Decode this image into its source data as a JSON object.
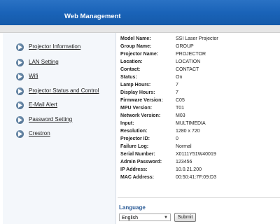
{
  "header": {
    "title": "Web Management"
  },
  "nav": {
    "items": [
      {
        "label": "Projector Information",
        "icon": "arrow-right-icon"
      },
      {
        "label": "LAN Setting",
        "icon": "arrow-right-icon"
      },
      {
        "label": "Wifi",
        "icon": "arrow-right-icon"
      },
      {
        "label": "Projector Status and Control",
        "icon": "arrow-right-icon"
      },
      {
        "label": "E-Mail Alert",
        "icon": "arrow-right-icon"
      },
      {
        "label": "Password Setting",
        "icon": "arrow-right-icon"
      },
      {
        "label": "Crestron",
        "icon": "arrow-right-icon"
      }
    ]
  },
  "info": {
    "rows": [
      {
        "label": "Model Name:",
        "value": "SSI Laser Projector"
      },
      {
        "label": "Group Name:",
        "value": "GROUP"
      },
      {
        "label": "Projector Name:",
        "value": "PROJECTOR"
      },
      {
        "label": "Location:",
        "value": "LOCATION"
      },
      {
        "label": "Contact:",
        "value": "CONTACT"
      },
      {
        "label": "Status:",
        "value": "On"
      },
      {
        "label": "Lamp Hours:",
        "value": "7"
      },
      {
        "label": "Display Hours:",
        "value": "7"
      },
      {
        "label": "Firmware Version:",
        "value": "C05"
      },
      {
        "label": "MPU Version:",
        "value": "T01"
      },
      {
        "label": "Network Version:",
        "value": "M03"
      },
      {
        "label": "Input:",
        "value": "MULTIMEDIA"
      },
      {
        "label": "Resolution:",
        "value": "1280 x 720"
      },
      {
        "label": "Projector ID:",
        "value": "0"
      },
      {
        "label": "Failure Log:",
        "value": "Normal"
      },
      {
        "label": "Serial Number:",
        "value": "X0111Y51W40019"
      },
      {
        "label": "Admin Password:",
        "value": "123456"
      },
      {
        "label": "IP Address:",
        "value": "10.0.21.200"
      },
      {
        "label": "MAC Address:",
        "value": "00:50:41:7F:09:D3"
      }
    ]
  },
  "language": {
    "heading": "Language",
    "selected": "English",
    "submit_label": "Submit"
  },
  "colors": {
    "header_bg": "#1a63b8",
    "sidebar_bg": "#f4f7fb",
    "language_heading": "#2a5a96"
  }
}
